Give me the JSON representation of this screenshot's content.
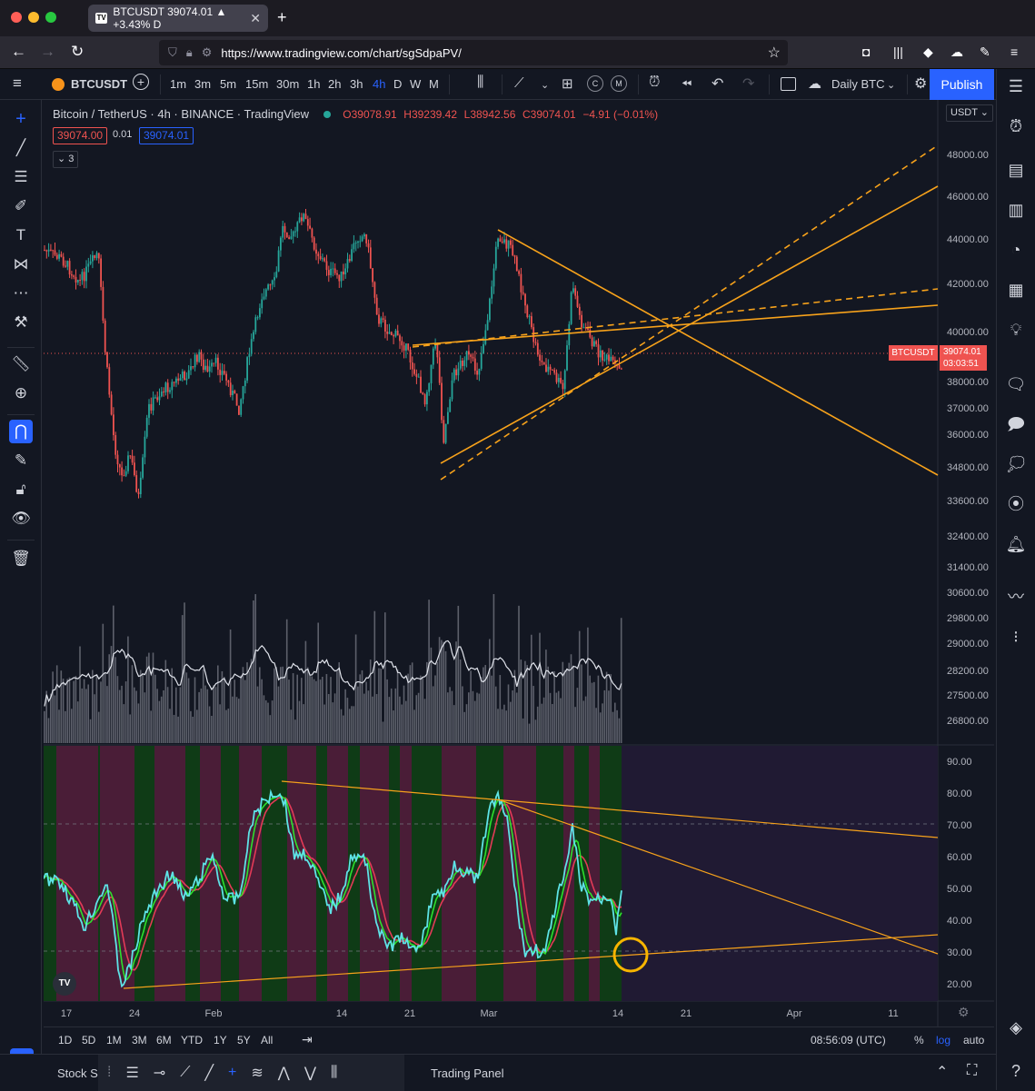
{
  "browser": {
    "tab_title": "BTCUSDT 39074.01 ▲ +3.43% D",
    "url": "https://www.tradingview.com/chart/sgSdpaPV/"
  },
  "toolbar": {
    "symbol": "BTCUSDT",
    "intervals": [
      "1m",
      "3m",
      "5m",
      "15m",
      "30m",
      "1h",
      "2h",
      "3h",
      "4h",
      "D",
      "W",
      "M"
    ],
    "active_interval": "4h",
    "layout_name": "Daily BTC",
    "publish_label": "Publish"
  },
  "legend": {
    "title": "Bitcoin / TetherUS · 4h · BINANCE · TradingView",
    "open": "O39078.91",
    "high": "H39239.42",
    "low": "L38942.56",
    "close": "C39074.01",
    "change": "−4.91 (−0.01%)",
    "bid": "39074.00",
    "spread": "0.01",
    "ask": "39074.01",
    "indicators_count": "3"
  },
  "price_axis": {
    "currency": "USDT",
    "labels": [
      "48000.00",
      "46000.00",
      "44000.00",
      "42000.00",
      "40000.00",
      "38000.00",
      "37000.00",
      "36000.00",
      "34800.00",
      "33600.00",
      "32400.00",
      "31400.00",
      "30600.00",
      "29800.00",
      "29000.00",
      "28200.00",
      "27500.00",
      "26800.00"
    ],
    "current_symbol": "BTCUSDT",
    "current_price": "39074.01",
    "countdown": "03:03:51"
  },
  "rsi_axis": {
    "labels": [
      "90.00",
      "80.00",
      "70.00",
      "60.00",
      "50.00",
      "40.00",
      "30.00",
      "20.00"
    ]
  },
  "time_axis": {
    "labels": [
      "17",
      "24",
      "Feb",
      "14",
      "21",
      "Mar",
      "14",
      "21",
      "Apr",
      "11"
    ]
  },
  "bottom": {
    "ranges": [
      "1D",
      "5D",
      "1M",
      "3M",
      "6M",
      "YTD",
      "1Y",
      "5Y",
      "All"
    ],
    "clock": "08:56:09 (UTC)",
    "percent": "%",
    "log": "log",
    "auto": "auto",
    "stock_screener": "Stock Sc",
    "trading_panel": "Trading Panel"
  },
  "colors": {
    "background": "#131722",
    "up": "#26a69a",
    "down": "#ef5350",
    "drawing": "#f7a21b",
    "accent": "#2962ff",
    "rsi": "#5ee3e6",
    "rsi_fast": "#2de02d",
    "rsi_slow": "#e33a57"
  }
}
